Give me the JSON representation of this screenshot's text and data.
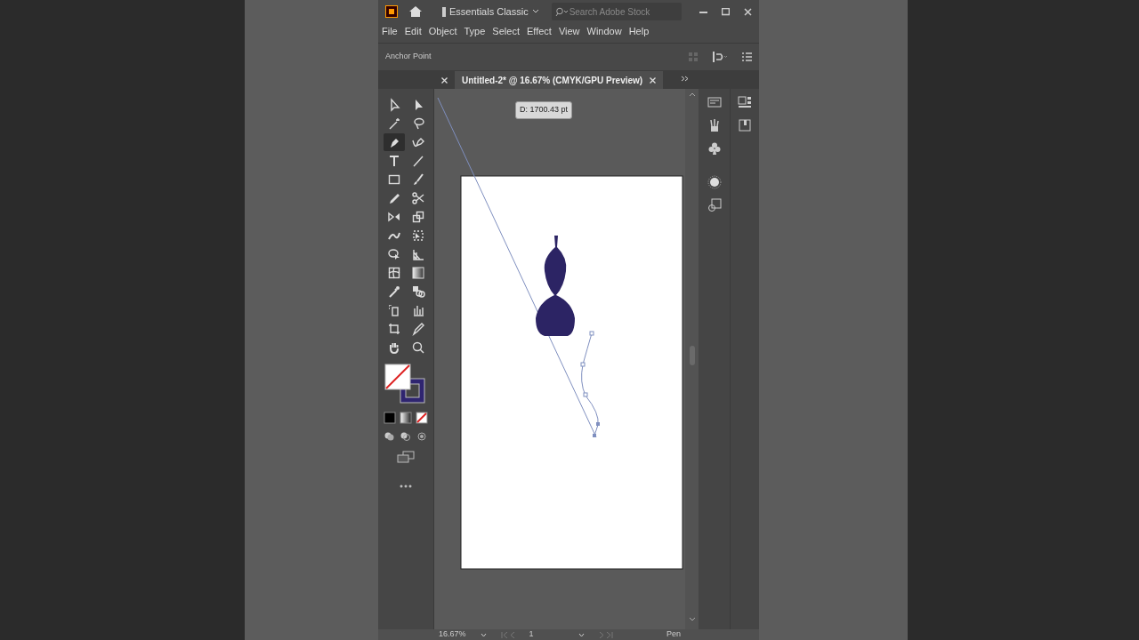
{
  "title_bar": {
    "workspace": "Essentials Classic",
    "search": {
      "placeholder": "Search Adobe Stock"
    }
  },
  "menu": [
    "File",
    "Edit",
    "Object",
    "Type",
    "Select",
    "Effect",
    "View",
    "Window",
    "Help"
  ],
  "control_bar": {
    "label": "Anchor Point"
  },
  "tabs": [
    {
      "selected": false
    },
    {
      "label": "Untitled-2* @ 16.67% (CMYK/GPU Preview)",
      "selected": true
    }
  ],
  "tools": [
    {
      "kind": "selection",
      "selected": false
    },
    {
      "kind": "direct",
      "selected": false
    },
    {
      "kind": "wand",
      "selected": false
    },
    {
      "kind": "lasso",
      "selected": false
    },
    {
      "kind": "pen",
      "selected": true
    },
    {
      "kind": "curvature",
      "selected": false
    },
    {
      "kind": "type",
      "selected": false
    },
    {
      "kind": "line",
      "selected": false
    },
    {
      "kind": "rect",
      "selected": false
    },
    {
      "kind": "brush",
      "selected": false
    },
    {
      "kind": "pencil",
      "selected": false
    },
    {
      "kind": "scissors",
      "selected": false
    },
    {
      "kind": "reflect",
      "selected": false
    },
    {
      "kind": "scale",
      "selected": false
    },
    {
      "kind": "warp",
      "selected": false
    },
    {
      "kind": "transform",
      "selected": false
    },
    {
      "kind": "builder",
      "selected": false
    },
    {
      "kind": "perspective",
      "selected": false
    },
    {
      "kind": "mesh",
      "selected": false
    },
    {
      "kind": "gradient",
      "selected": false
    },
    {
      "kind": "eyedropper",
      "selected": false
    },
    {
      "kind": "blend",
      "selected": false
    },
    {
      "kind": "sprayer",
      "selected": false
    },
    {
      "kind": "graph",
      "selected": false
    },
    {
      "kind": "artboard",
      "selected": false
    },
    {
      "kind": "slice",
      "selected": false
    },
    {
      "kind": "hand",
      "selected": false
    },
    {
      "kind": "zoom",
      "selected": false
    }
  ],
  "tooltip": "D: 1700.43 pt",
  "status_bar": {
    "zoom": "16.67%",
    "artboard": "1",
    "tool": "Pen"
  }
}
